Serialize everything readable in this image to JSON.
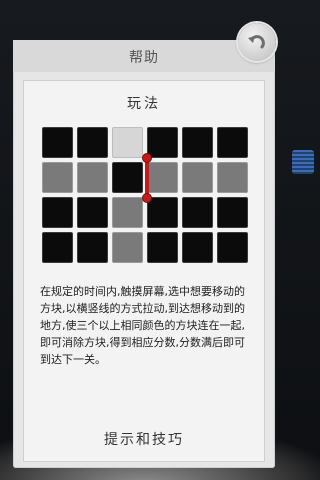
{
  "header": {
    "title": "帮助"
  },
  "howto": {
    "title": "玩法"
  },
  "instructions": {
    "text": "在规定的时间内,触摸屏幕,选中想要移动的方块,以横竖线的方式拉动,到达想移动到的地方,使三个以上相同颜色的方块连在一起,即可消除方块,得到相应分数,分数满后即可到达下一关。"
  },
  "tips": {
    "label": "提示和技巧"
  },
  "icons": {
    "back": "back-arrow-icon",
    "drag_handle": "drag-handle-icon"
  },
  "colors": {
    "accent_red": "#c41b1b",
    "dialog_bg": "#e6e6e6",
    "cell_black": "#0b0b0b",
    "cell_gray": "#7a7a7a"
  }
}
